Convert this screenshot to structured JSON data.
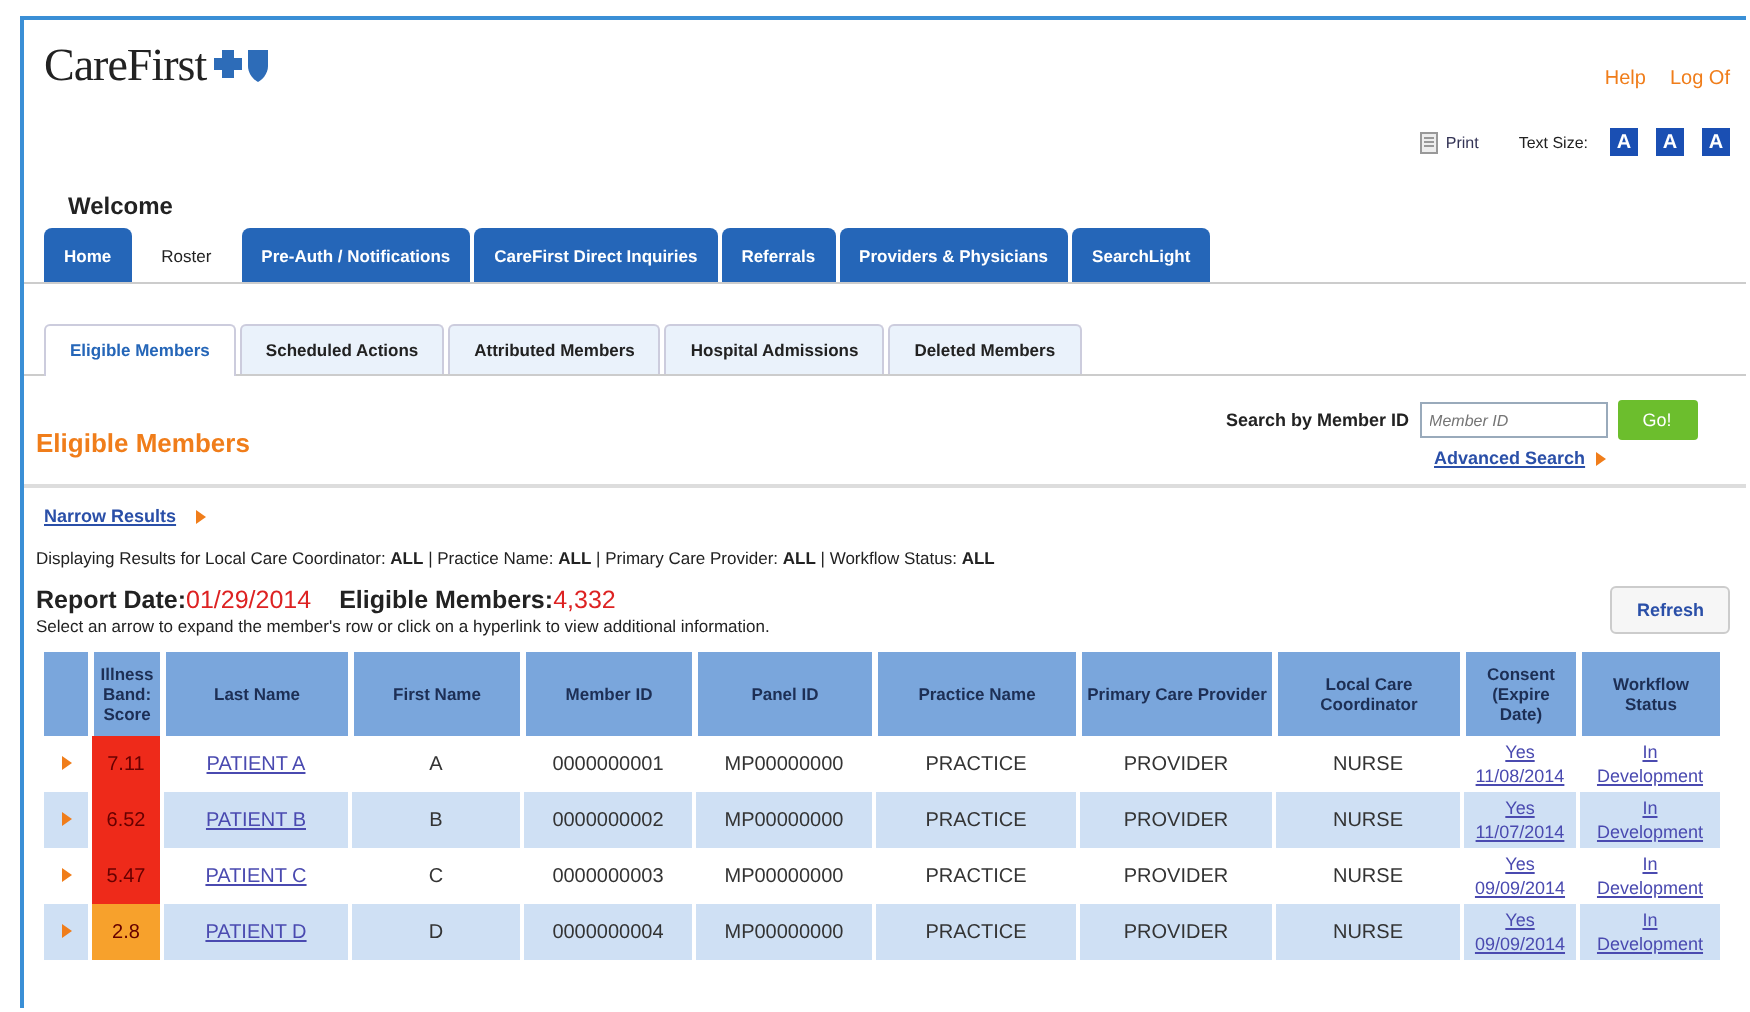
{
  "header": {
    "logo": "CareFirst",
    "links": [
      "Help",
      "Log Of"
    ],
    "print": "Print",
    "text_size_label": "Text Size:",
    "text_size_buttons": [
      "A",
      "A",
      "A"
    ],
    "welcome": "Welcome"
  },
  "main_tabs": [
    {
      "label": "Home",
      "selected": false
    },
    {
      "label": "Roster",
      "selected": true
    },
    {
      "label": "Pre-Auth / Notifications",
      "selected": false
    },
    {
      "label": "CareFirst Direct Inquiries",
      "selected": false
    },
    {
      "label": "Referrals",
      "selected": false
    },
    {
      "label": "Providers & Physicians",
      "selected": false
    },
    {
      "label": "SearchLight",
      "selected": false
    }
  ],
  "sub_tabs": [
    {
      "label": "Eligible Members",
      "selected": true
    },
    {
      "label": "Scheduled Actions",
      "selected": false
    },
    {
      "label": "Attributed Members",
      "selected": false
    },
    {
      "label": "Hospital Admissions",
      "selected": false
    },
    {
      "label": "Deleted Members",
      "selected": false
    }
  ],
  "page_title": "Eligible Members",
  "search": {
    "label": "Search by Member ID",
    "placeholder": "Member ID",
    "button": "Go!",
    "advanced": "Advanced Search"
  },
  "narrow_results": "Narrow Results",
  "filters": "Displaying Results for Local Care Coordinator: **ALL** | Practice Name: **ALL** | Primary Care Provider: **ALL** | Workflow Status: **ALL**",
  "report_date_label": "Report Date:",
  "report_date": "01/29/2014",
  "eligible_label": "Eligible Members:",
  "eligible_count": "4,332",
  "instructions": "Select an arrow to expand the member's row or click on a hyperlink to view additional information.",
  "refresh": "Refresh",
  "table": {
    "columns": [
      "Illness Band: Score",
      "Last Name",
      "First Name",
      "Member ID",
      "Panel ID",
      "Practice Name",
      "Primary Care Provider",
      "Local Care Coordinator",
      "Consent (Expire Date)",
      "Workflow Status"
    ],
    "rows": [
      {
        "score": "7.11",
        "color": "#ee2a1a",
        "last": "PATIENT A",
        "first": "A",
        "member_id": "0000000001",
        "panel_id": "MP00000000",
        "practice": "PRACTICE",
        "provider": "PROVIDER",
        "coordinator": "NURSE",
        "consent": "Yes",
        "expire": "11/08/2014",
        "status_1": "In",
        "status_2": "Development"
      },
      {
        "score": "6.52",
        "color": "#ee2a1a",
        "last": "PATIENT B",
        "first": "B",
        "member_id": "0000000002",
        "panel_id": "MP00000000",
        "practice": "PRACTICE",
        "provider": "PROVIDER",
        "coordinator": "NURSE",
        "consent": "Yes",
        "expire": "11/07/2014",
        "status_1": "In",
        "status_2": "Development"
      },
      {
        "score": "5.47",
        "color": "#ee2a1a",
        "last": "PATIENT C",
        "first": "C",
        "member_id": "0000000003",
        "panel_id": "MP00000000",
        "practice": "PRACTICE",
        "provider": "PROVIDER",
        "coordinator": "NURSE",
        "consent": "Yes",
        "expire": "09/09/2014",
        "status_1": "In",
        "status_2": "Development"
      },
      {
        "score": "2.8",
        "color": "#f7a12c",
        "last": "PATIENT D",
        "first": "D",
        "member_id": "0000000004",
        "panel_id": "MP00000000",
        "practice": "PRACTICE",
        "provider": "PROVIDER",
        "coordinator": "NURSE",
        "consent": "Yes",
        "expire": "09/09/2014",
        "status_1": "In",
        "status_2": "Development"
      }
    ]
  }
}
